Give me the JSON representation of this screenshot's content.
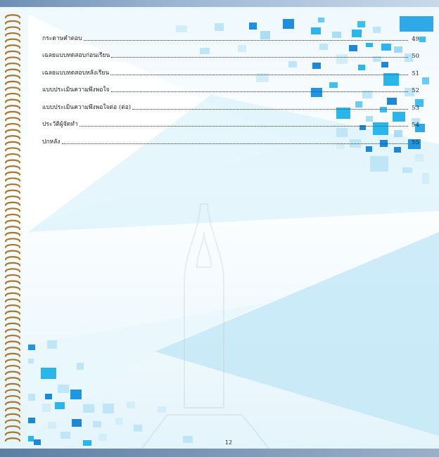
{
  "toc": {
    "entries": [
      {
        "title": "กระดาษคำตอบ",
        "page": "49"
      },
      {
        "title": "เฉลยแบบทดสอบก่อนเรียน",
        "page": "50"
      },
      {
        "title": "เฉลยแบบทดสอบหลังเรียน",
        "page": "51"
      },
      {
        "title": "แบบประเมินความพึงพอใจ",
        "page": "52"
      },
      {
        "title": "แบบประเมินความพึงพอใจต่อ (ต่อ)",
        "page": "53"
      },
      {
        "title": "ประวัติผู้จัดทำ",
        "page": "54"
      },
      {
        "title": "ปกหลัง",
        "page": "55"
      }
    ]
  },
  "footer": {
    "page_number": "12"
  },
  "colors": {
    "accent": "#29b6e8",
    "accent_dark": "#1e88d6",
    "light": "#bfe6f6",
    "binding": "#a6772f"
  }
}
